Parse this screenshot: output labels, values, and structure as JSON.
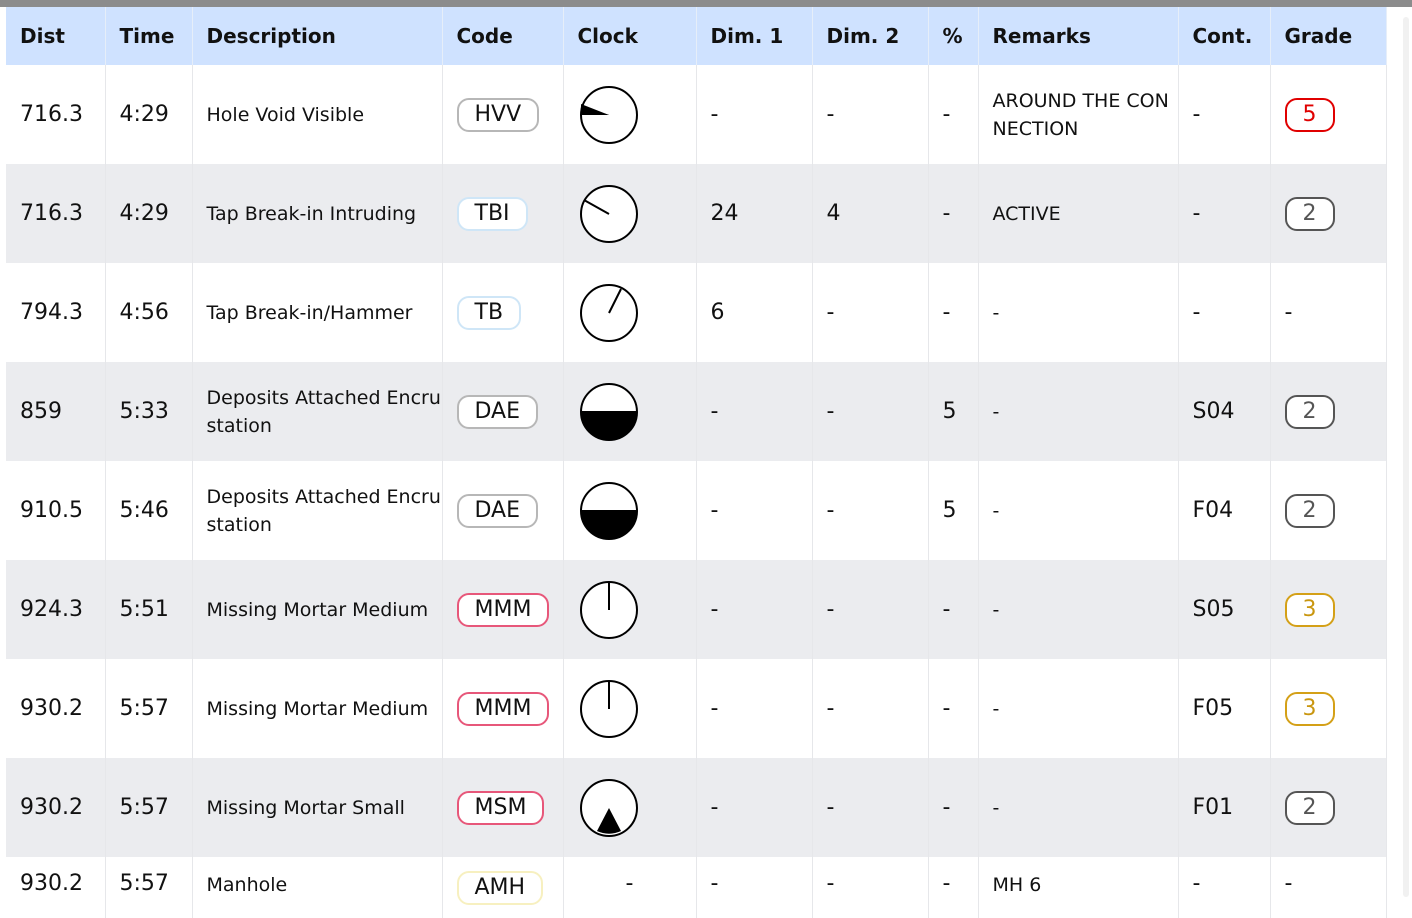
{
  "headers": {
    "dist": "Dist",
    "time": "Time",
    "description": "Description",
    "code": "Code",
    "clock": "Clock",
    "dim1": "Dim. 1",
    "dim2": "Dim. 2",
    "percent": "%",
    "remarks": "Remarks",
    "cont": "Cont.",
    "grade": "Grade"
  },
  "rows": [
    {
      "dist": "716.3",
      "time": "4:29",
      "description": "Hole Void Visible",
      "code": "HVV",
      "clock_icon": "clock-wedge-9-icon",
      "dim1": "-",
      "dim2": "-",
      "percent": "-",
      "remarks": "AROUND THE CONNECTION",
      "cont": "-",
      "grade": "5",
      "grade_color": "#e00000"
    },
    {
      "dist": "716.3",
      "time": "4:29",
      "description": "Tap Break-in Intruding",
      "code": "TBI",
      "clock_icon": "clock-hand-10-icon",
      "dim1": "24",
      "dim2": "4",
      "percent": "-",
      "remarks": "ACTIVE",
      "cont": "-",
      "grade": "2",
      "grade_color": "#555555"
    },
    {
      "dist": "794.3",
      "time": "4:56",
      "description": "Tap Break-in/Hammer",
      "code": "TB",
      "clock_icon": "clock-hand-1-icon",
      "dim1": "6",
      "dim2": "-",
      "percent": "-",
      "remarks": "-",
      "cont": "-",
      "grade": "-",
      "grade_color": ""
    },
    {
      "dist": "859",
      "time": "5:33",
      "description": "Deposits Attached Encrustation",
      "code": "DAE",
      "clock_icon": "clock-half-bottom-icon",
      "dim1": "-",
      "dim2": "-",
      "percent": "5",
      "remarks": "-",
      "cont": "S04",
      "grade": "2",
      "grade_color": "#555555"
    },
    {
      "dist": "910.5",
      "time": "5:46",
      "description": "Deposits Attached Encrustation",
      "code": "DAE",
      "clock_icon": "clock-half-bottom-icon",
      "dim1": "-",
      "dim2": "-",
      "percent": "5",
      "remarks": "-",
      "cont": "F04",
      "grade": "2",
      "grade_color": "#555555"
    },
    {
      "dist": "924.3",
      "time": "5:51",
      "description": "Missing Mortar Medium",
      "code": "MMM",
      "clock_icon": "clock-hand-12-icon",
      "dim1": "-",
      "dim2": "-",
      "percent": "-",
      "remarks": "-",
      "cont": "S05",
      "grade": "3",
      "grade_color": "#c9960f"
    },
    {
      "dist": "930.2",
      "time": "5:57",
      "description": "Missing Mortar Medium",
      "code": "MMM",
      "clock_icon": "clock-hand-12-icon",
      "dim1": "-",
      "dim2": "-",
      "percent": "-",
      "remarks": "-",
      "cont": "F05",
      "grade": "3",
      "grade_color": "#c9960f"
    },
    {
      "dist": "930.2",
      "time": "5:57",
      "description": "Missing Mortar Small",
      "code": "MSM",
      "clock_icon": "clock-wedge-6-icon",
      "dim1": "-",
      "dim2": "-",
      "percent": "-",
      "remarks": "-",
      "cont": "F01",
      "grade": "2",
      "grade_color": "#555555"
    },
    {
      "dist": "930.2",
      "time": "5:57",
      "description": "Manhole",
      "code": "AMH",
      "clock_icon": "",
      "clock_text": "-",
      "dim1": "-",
      "dim2": "-",
      "percent": "-",
      "remarks": "MH 6",
      "cont": "-",
      "grade": "-",
      "grade_color": ""
    }
  ]
}
